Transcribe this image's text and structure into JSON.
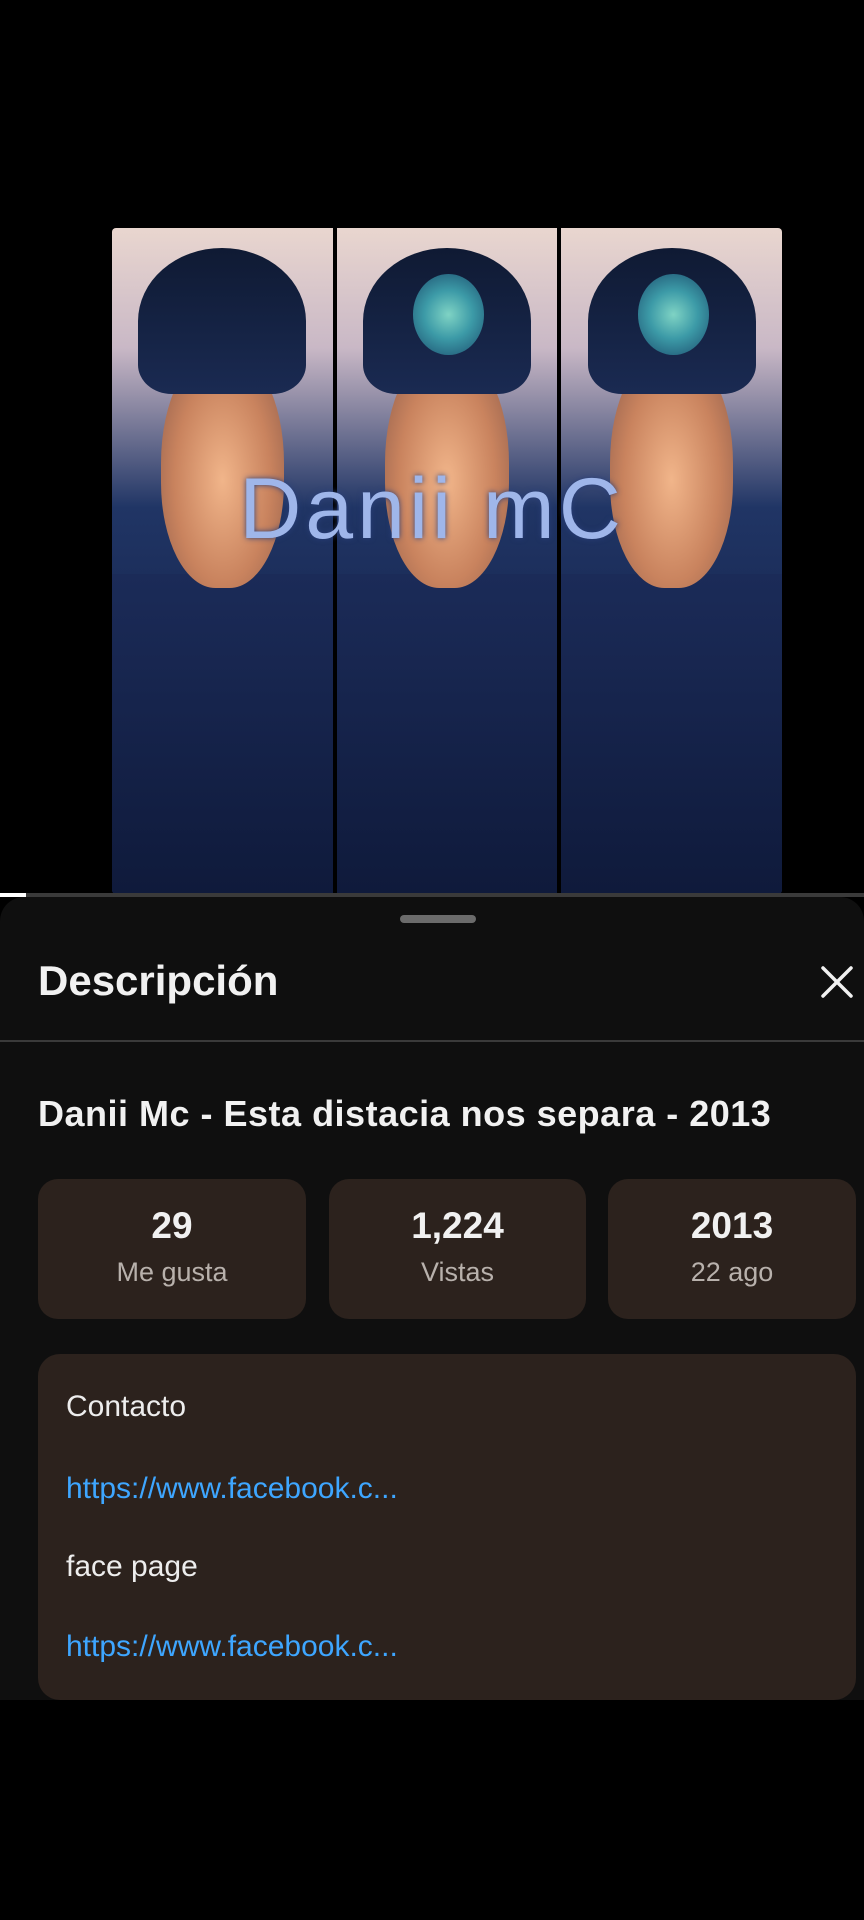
{
  "video": {
    "watermark_text": "Danii mC",
    "progress_fraction": 0.03
  },
  "sheet": {
    "title": "Descripción",
    "close_icon": "close-icon",
    "video_title": "Danii Mc - Esta distacia nos separa - 2013",
    "stats": [
      {
        "value": "29",
        "label": "Me gusta"
      },
      {
        "value": "1,224",
        "label": "Vistas"
      },
      {
        "value": "2013",
        "label": "22 ago"
      }
    ],
    "description": [
      {
        "text": "Contacto",
        "type": "text"
      },
      {
        "text": "https://www.facebook.c...",
        "type": "link"
      },
      {
        "text": "face page",
        "type": "text"
      },
      {
        "text": "https://www.facebook.c...",
        "type": "link"
      }
    ]
  },
  "colors": {
    "link": "#3ea6ff",
    "card": "#2c221d",
    "sheet_bg": "#0f0f0f"
  }
}
